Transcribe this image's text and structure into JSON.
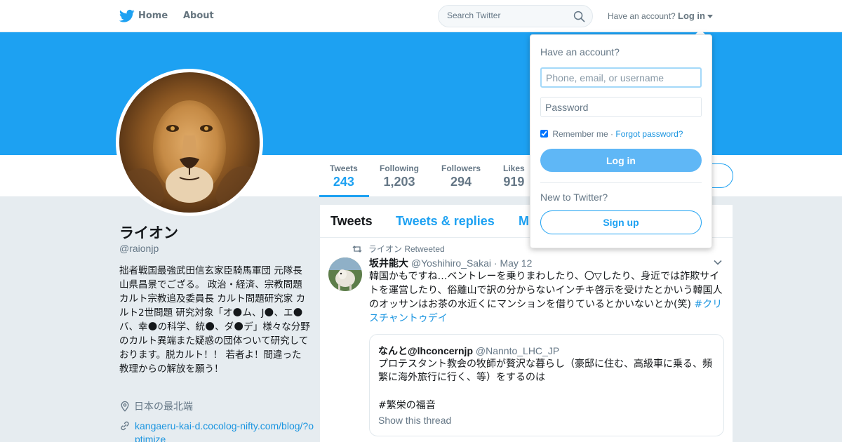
{
  "nav": {
    "home_label": "Home",
    "about_label": "About",
    "search_placeholder": "Search Twitter",
    "have_account": "Have an account?",
    "login_label": "Log in",
    "logo_icon": "twitter-bird-icon",
    "brand_color": "#1da1f2"
  },
  "profile": {
    "name": "ライオン",
    "handle": "@raionjp",
    "bio": "拙者戦国最強武田信玄家臣騎馬軍団 元隊長山県昌景でござる。 政治・経済、宗教問題 カルト宗教追及委員長 カルト問題研究家 カルト2世問題 研究対象「オ🌑ム、J🌑、エ🌑バ、幸🌑の科学、統🌑、ダ🌑デ」様々な分野のカルト異端また疑惑の団体ついて研究しております。脱カルト！！ 若者よ！間違った教理からの解放を願う！",
    "location": "日本の最北端",
    "url": "kangaeru-kai-d.cocolog-nifty.com/blog/?optimize",
    "banner_color": "#1da1f2"
  },
  "stats": [
    {
      "label": "Tweets",
      "value": "243"
    },
    {
      "label": "Following",
      "value": "1,203"
    },
    {
      "label": "Followers",
      "value": "294"
    },
    {
      "label": "Likes",
      "value": "919"
    }
  ],
  "timeline": {
    "tabs": [
      "Tweets",
      "Tweets & replies",
      "M"
    ],
    "retweet_by": "ライオン Retweeted",
    "tweet": {
      "name": "坂井能大",
      "handle": "@Yoshihiro_Sakai",
      "date": "· May 12",
      "text": "韓国かもですね…ベントレーを乗りまわしたり、〇▽したり、身近では詐欺サイトを運営したり、俗離山で訳の分からないインチキ啓示を受けたとかいう韓国人のオッサンはお茶の水近くにマンションを借りているとかいないとか(笑)",
      "hashtag": "#クリスチャントゥデイ"
    },
    "quote": {
      "name": "なんと@lhconcernjp",
      "handle": "@Nannto_LHC_JP",
      "text": "プロテスタント教会の牧師が贅沢な暮らし（豪邸に住む、高級車に乗る、頻繁に海外旅行に行く、等）をするのは",
      "tag": "#繁栄の福音",
      "show_thread": "Show this thread"
    }
  },
  "login_dropdown": {
    "title": "Have an account?",
    "username_placeholder": "Phone, email, or username",
    "password_placeholder": "Password",
    "remember_label": "Remember me",
    "separator": "·",
    "forgot_label": "Forgot password?",
    "login_button": "Log in",
    "new_to_twitter": "New to Twitter?",
    "signup_button": "Sign up"
  }
}
